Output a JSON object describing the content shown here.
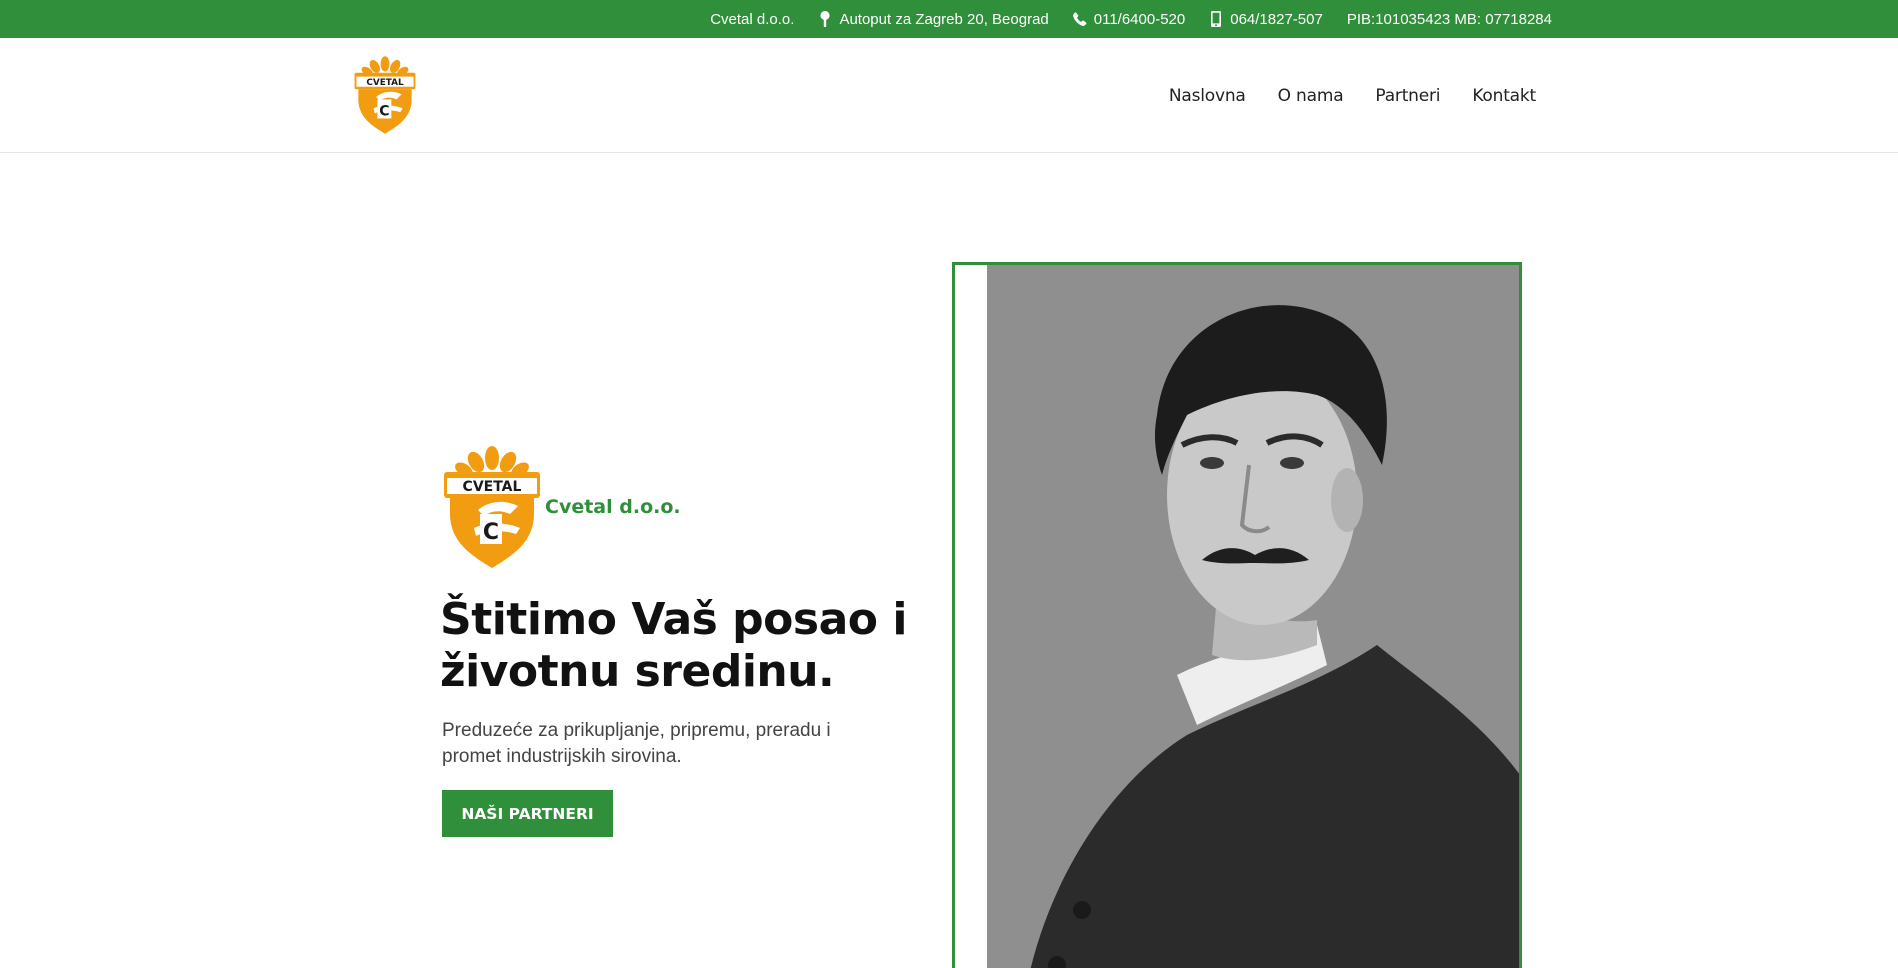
{
  "topbar": {
    "company": "Cvetal d.o.o.",
    "address": "Autoput za Zagreb 20, Beograd",
    "phone": "011/6400-520",
    "mobile": "064/1827-507",
    "ids": "PIB:101035423 MB: 07718284"
  },
  "logo": {
    "text": "CVETAL",
    "letter": "C"
  },
  "nav": {
    "items": [
      "Naslovna",
      "O nama",
      "Partneri",
      "Kontakt"
    ]
  },
  "hero": {
    "brand": "Cvetal d.o.o.",
    "title": "Štitimo Vaš posao i životnu sredinu.",
    "subtitle": "Preduzeće za prikupljanje, pripremu, preradu i promet industrijskih sirovina.",
    "button_label": "NAŠI PARTNERI"
  },
  "colors": {
    "brand_green": "#2f8f3a",
    "logo_orange": "#f29c11"
  },
  "icons": {
    "address": "map-pin-icon",
    "phone": "phone-icon",
    "mobile": "mobile-icon"
  }
}
